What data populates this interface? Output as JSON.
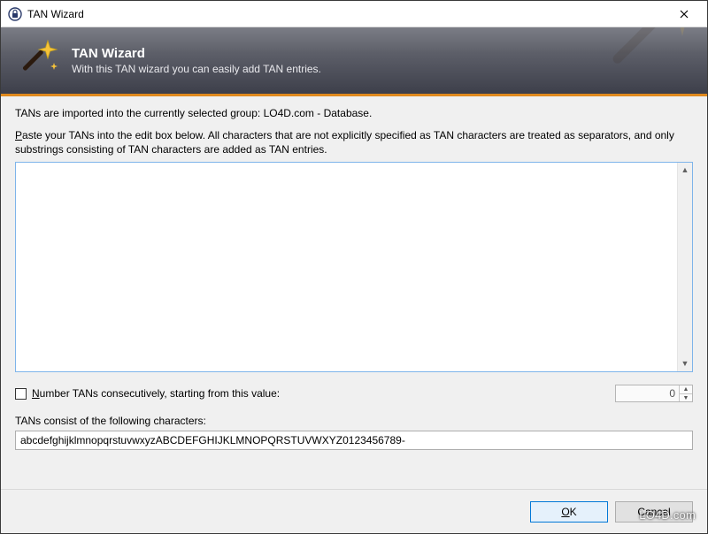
{
  "window": {
    "title": "TAN Wizard"
  },
  "banner": {
    "heading": "TAN Wizard",
    "subtitle": "With this TAN wizard you can easily add TAN entries."
  },
  "body": {
    "import_line_prefix": "TANs are imported into the currently selected group: ",
    "import_group": "LO4D.com - Database",
    "import_line_suffix": ".",
    "paste_label_mnemonic": "P",
    "paste_label_rest": "aste your TANs into the edit box below. All characters that are not explicitly specified as TAN characters are treated as separators, and only substrings consisting of TAN characters are added as TAN entries.",
    "tan_textarea_value": "",
    "number_checkbox_checked": false,
    "number_label_mnemonic": "N",
    "number_label_rest": "umber TANs consecutively, starting from this value:",
    "number_start_value": "0",
    "chars_label": "TANs consist of the following characters:",
    "chars_value": "abcdefghijklmnopqrstuvwxyzABCDEFGHIJKLMNOPQRSTUVWXYZ0123456789-"
  },
  "footer": {
    "ok_mnemonic": "O",
    "ok_rest": "K",
    "cancel": "Cancel"
  },
  "watermark": "LO4D.com"
}
